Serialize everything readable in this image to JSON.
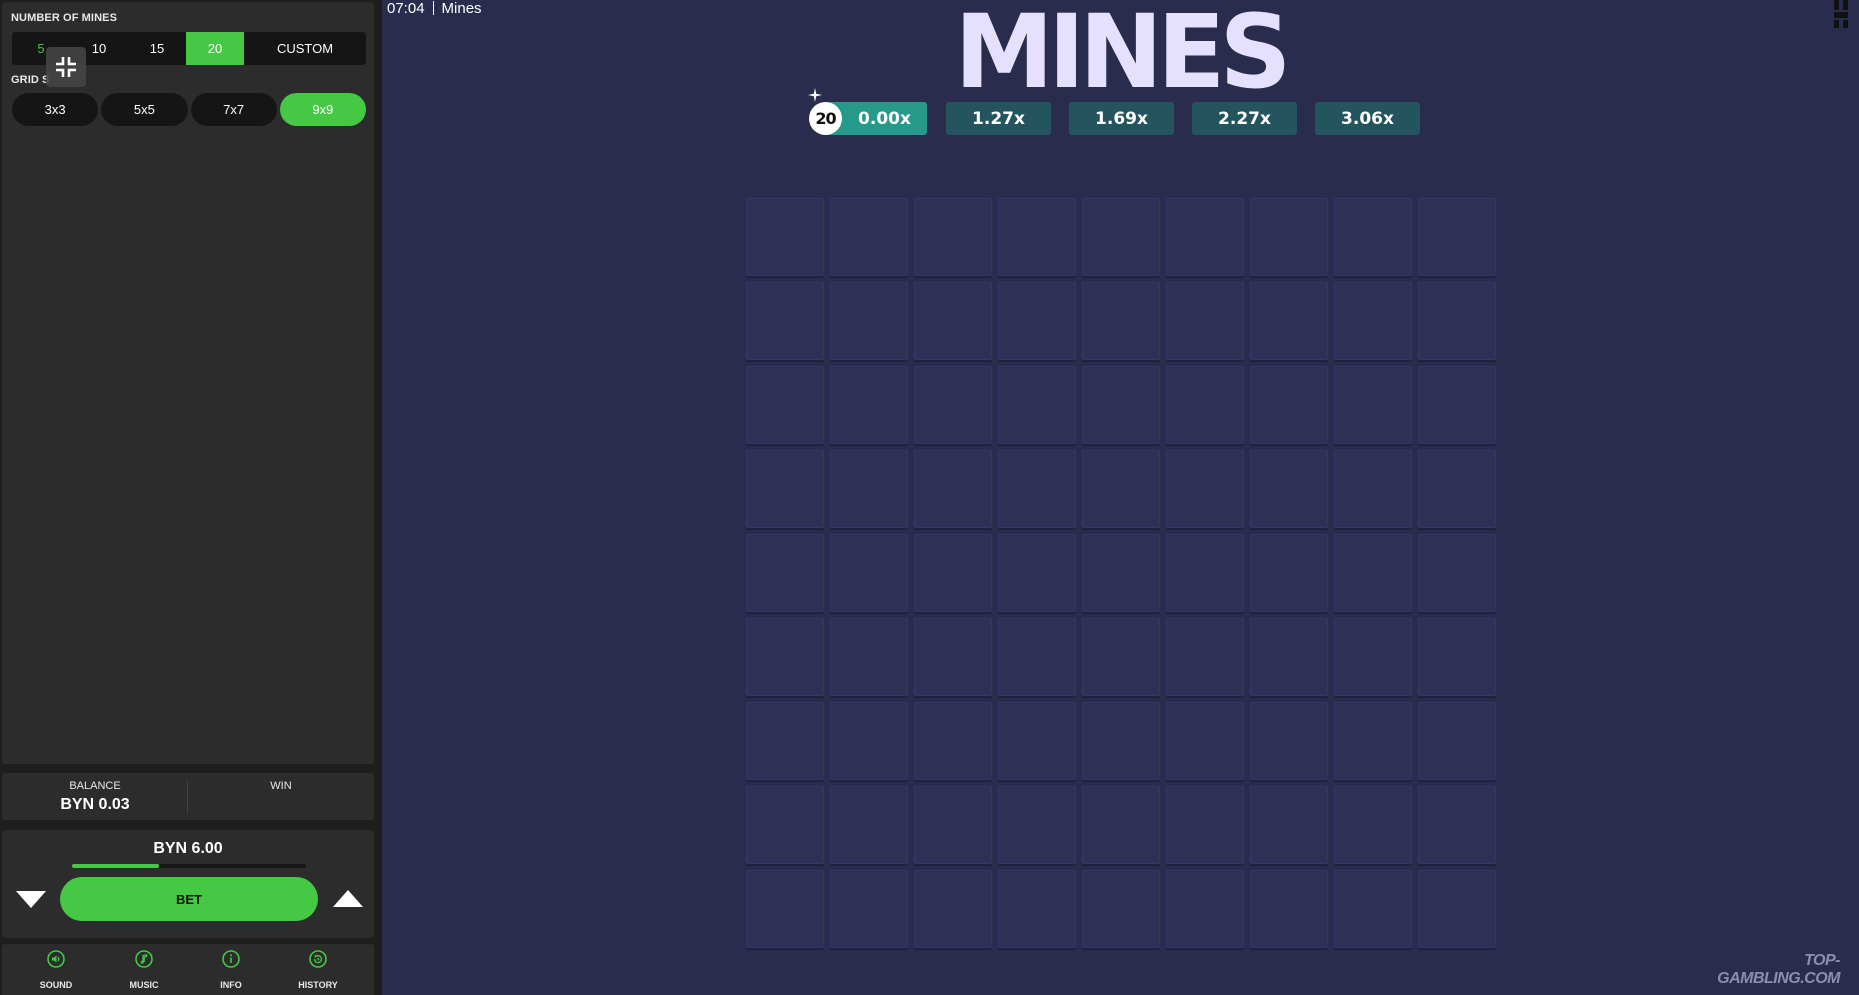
{
  "header": {
    "time": "07:04",
    "game_name": "Mines"
  },
  "settings": {
    "mines_label": "NUMBER OF MINES",
    "mines_options": [
      "5",
      "10",
      "15",
      "20",
      "CUSTOM"
    ],
    "mines_selected": "20",
    "grid_label": "GRID S",
    "grid_options": [
      "3x3",
      "5x5",
      "7x7",
      "9x9"
    ],
    "grid_selected": "9x9"
  },
  "balance": {
    "label": "BALANCE",
    "value": "BYN 0.03"
  },
  "win": {
    "label": "WIN",
    "value": ""
  },
  "bet": {
    "amount": "BYN 6.00",
    "slider_fraction": 0.37,
    "button_label": "BET"
  },
  "footer": [
    "SOUND",
    "MUSIC",
    "INFO",
    "HISTORY"
  ],
  "game": {
    "title": "MINES",
    "mines_count": "20",
    "multipliers": [
      "0.00x",
      "1.27x",
      "1.69x",
      "2.27x",
      "3.06x"
    ],
    "grid_size": 9
  },
  "watermark": "TOP-GAMBLING.COM",
  "colors": {
    "accent": "#45c945",
    "board_bg": "#2a2c4d",
    "tile": "#2e3056",
    "multiplier_active": "#259a8a",
    "multiplier": "#24555f"
  },
  "icons": {
    "shrink": "collapse-icon",
    "sound": "sound-icon",
    "music": "music-note-icon",
    "info": "info-icon",
    "history": "history-icon"
  }
}
